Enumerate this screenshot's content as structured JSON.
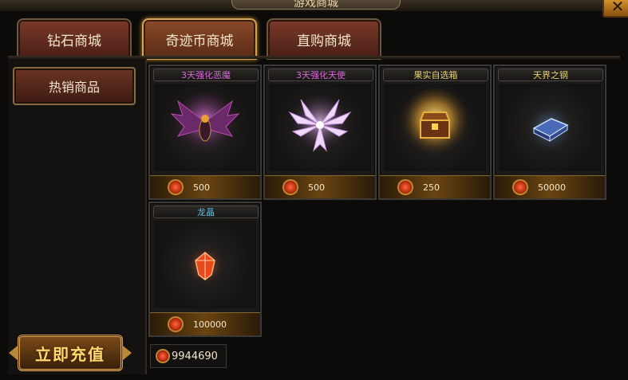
{
  "window": {
    "title": "游戏商城",
    "close_label": "✕"
  },
  "tabs": [
    {
      "label": "钻石商城",
      "active": false
    },
    {
      "label": "奇迹币商城",
      "active": true
    },
    {
      "label": "直购商城",
      "active": false
    }
  ],
  "sidebar": {
    "items": [
      {
        "label": "热销商品"
      }
    ],
    "recharge_label": "立即充值"
  },
  "items": [
    {
      "name": "3天强化恶魔",
      "name_color": "#d66ad6",
      "price": "500",
      "icon": "demon-wings-icon"
    },
    {
      "name": "3天强化天使",
      "name_color": "#d66ad6",
      "price": "500",
      "icon": "angel-wings-icon"
    },
    {
      "name": "果实自选箱",
      "name_color": "#e8d070",
      "price": "250",
      "icon": "treasure-chest-icon"
    },
    {
      "name": "天界之钢",
      "name_color": "#e8d070",
      "price": "50000",
      "icon": "celestial-steel-icon"
    },
    {
      "name": "龙晶",
      "name_color": "#5ac0e8",
      "price": "100000",
      "icon": "dragon-crystal-icon"
    }
  ],
  "balance": {
    "value": "9944690",
    "icon": "miracle-coin-icon"
  }
}
